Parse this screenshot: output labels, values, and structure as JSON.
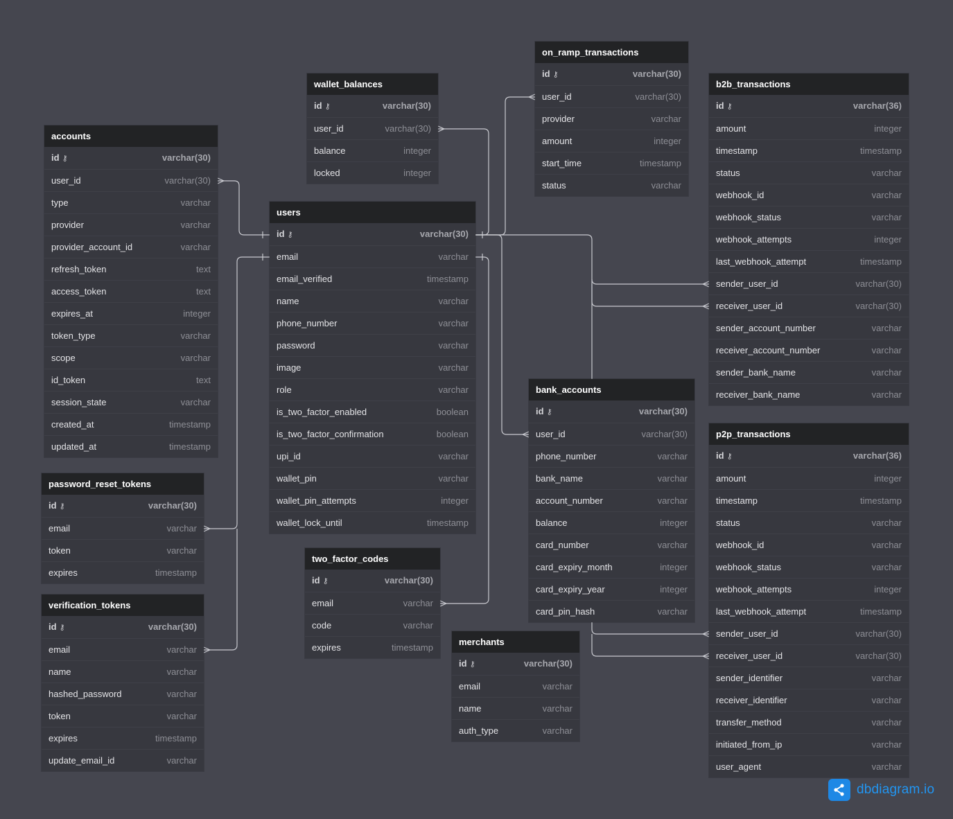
{
  "brand": {
    "name": "dbdiagram.io",
    "logo_icon": "share-nodes-icon"
  },
  "colors": {
    "background": "#45464f",
    "table_body": "#37383f",
    "table_header": "#222325",
    "link": "#c9cad0",
    "brand": "#2196f3"
  },
  "tables": [
    {
      "id": "accounts",
      "name": "accounts",
      "fields": [
        {
          "name": "id",
          "type": "varchar(30)",
          "pk": true
        },
        {
          "name": "user_id",
          "type": "varchar(30)"
        },
        {
          "name": "type",
          "type": "varchar"
        },
        {
          "name": "provider",
          "type": "varchar"
        },
        {
          "name": "provider_account_id",
          "type": "varchar"
        },
        {
          "name": "refresh_token",
          "type": "text"
        },
        {
          "name": "access_token",
          "type": "text"
        },
        {
          "name": "expires_at",
          "type": "integer"
        },
        {
          "name": "token_type",
          "type": "varchar"
        },
        {
          "name": "scope",
          "type": "varchar"
        },
        {
          "name": "id_token",
          "type": "text"
        },
        {
          "name": "session_state",
          "type": "varchar"
        },
        {
          "name": "created_at",
          "type": "timestamp"
        },
        {
          "name": "updated_at",
          "type": "timestamp"
        }
      ]
    },
    {
      "id": "password_reset_tokens",
      "name": "password_reset_tokens",
      "fields": [
        {
          "name": "id",
          "type": "varchar(30)",
          "pk": true
        },
        {
          "name": "email",
          "type": "varchar"
        },
        {
          "name": "token",
          "type": "varchar"
        },
        {
          "name": "expires",
          "type": "timestamp"
        }
      ]
    },
    {
      "id": "verification_tokens",
      "name": "verification_tokens",
      "fields": [
        {
          "name": "id",
          "type": "varchar(30)",
          "pk": true
        },
        {
          "name": "email",
          "type": "varchar"
        },
        {
          "name": "name",
          "type": "varchar"
        },
        {
          "name": "hashed_password",
          "type": "varchar"
        },
        {
          "name": "token",
          "type": "varchar"
        },
        {
          "name": "expires",
          "type": "timestamp"
        },
        {
          "name": "update_email_id",
          "type": "varchar"
        }
      ]
    },
    {
      "id": "wallet_balances",
      "name": "wallet_balances",
      "fields": [
        {
          "name": "id",
          "type": "varchar(30)",
          "pk": true
        },
        {
          "name": "user_id",
          "type": "varchar(30)"
        },
        {
          "name": "balance",
          "type": "integer"
        },
        {
          "name": "locked",
          "type": "integer"
        }
      ]
    },
    {
      "id": "users",
      "name": "users",
      "fields": [
        {
          "name": "id",
          "type": "varchar(30)",
          "pk": true
        },
        {
          "name": "email",
          "type": "varchar"
        },
        {
          "name": "email_verified",
          "type": "timestamp"
        },
        {
          "name": "name",
          "type": "varchar"
        },
        {
          "name": "phone_number",
          "type": "varchar"
        },
        {
          "name": "password",
          "type": "varchar"
        },
        {
          "name": "image",
          "type": "varchar"
        },
        {
          "name": "role",
          "type": "varchar"
        },
        {
          "name": "is_two_factor_enabled",
          "type": "boolean"
        },
        {
          "name": "is_two_factor_confirmation",
          "type": "boolean"
        },
        {
          "name": "upi_id",
          "type": "varchar"
        },
        {
          "name": "wallet_pin",
          "type": "varchar"
        },
        {
          "name": "wallet_pin_attempts",
          "type": "integer"
        },
        {
          "name": "wallet_lock_until",
          "type": "timestamp"
        }
      ]
    },
    {
      "id": "two_factor_codes",
      "name": "two_factor_codes",
      "fields": [
        {
          "name": "id",
          "type": "varchar(30)",
          "pk": true
        },
        {
          "name": "email",
          "type": "varchar"
        },
        {
          "name": "code",
          "type": "varchar"
        },
        {
          "name": "expires",
          "type": "timestamp"
        }
      ]
    },
    {
      "id": "on_ramp_transactions",
      "name": "on_ramp_transactions",
      "fields": [
        {
          "name": "id",
          "type": "varchar(30)",
          "pk": true
        },
        {
          "name": "user_id",
          "type": "varchar(30)"
        },
        {
          "name": "provider",
          "type": "varchar"
        },
        {
          "name": "amount",
          "type": "integer"
        },
        {
          "name": "start_time",
          "type": "timestamp"
        },
        {
          "name": "status",
          "type": "varchar"
        }
      ]
    },
    {
      "id": "bank_accounts",
      "name": "bank_accounts",
      "fields": [
        {
          "name": "id",
          "type": "varchar(30)",
          "pk": true
        },
        {
          "name": "user_id",
          "type": "varchar(30)"
        },
        {
          "name": "phone_number",
          "type": "varchar"
        },
        {
          "name": "bank_name",
          "type": "varchar"
        },
        {
          "name": "account_number",
          "type": "varchar"
        },
        {
          "name": "balance",
          "type": "integer"
        },
        {
          "name": "card_number",
          "type": "varchar"
        },
        {
          "name": "card_expiry_month",
          "type": "integer"
        },
        {
          "name": "card_expiry_year",
          "type": "integer"
        },
        {
          "name": "card_pin_hash",
          "type": "varchar"
        }
      ]
    },
    {
      "id": "merchants",
      "name": "merchants",
      "fields": [
        {
          "name": "id",
          "type": "varchar(30)",
          "pk": true
        },
        {
          "name": "email",
          "type": "varchar"
        },
        {
          "name": "name",
          "type": "varchar"
        },
        {
          "name": "auth_type",
          "type": "varchar"
        }
      ]
    },
    {
      "id": "b2b_transactions",
      "name": "b2b_transactions",
      "fields": [
        {
          "name": "id",
          "type": "varchar(36)",
          "pk": true
        },
        {
          "name": "amount",
          "type": "integer"
        },
        {
          "name": "timestamp",
          "type": "timestamp"
        },
        {
          "name": "status",
          "type": "varchar"
        },
        {
          "name": "webhook_id",
          "type": "varchar"
        },
        {
          "name": "webhook_status",
          "type": "varchar"
        },
        {
          "name": "webhook_attempts",
          "type": "integer"
        },
        {
          "name": "last_webhook_attempt",
          "type": "timestamp"
        },
        {
          "name": "sender_user_id",
          "type": "varchar(30)"
        },
        {
          "name": "receiver_user_id",
          "type": "varchar(30)"
        },
        {
          "name": "sender_account_number",
          "type": "varchar"
        },
        {
          "name": "receiver_account_number",
          "type": "varchar"
        },
        {
          "name": "sender_bank_name",
          "type": "varchar"
        },
        {
          "name": "receiver_bank_name",
          "type": "varchar"
        }
      ]
    },
    {
      "id": "p2p_transactions",
      "name": "p2p_transactions",
      "fields": [
        {
          "name": "id",
          "type": "varchar(36)",
          "pk": true
        },
        {
          "name": "amount",
          "type": "integer"
        },
        {
          "name": "timestamp",
          "type": "timestamp"
        },
        {
          "name": "status",
          "type": "varchar"
        },
        {
          "name": "webhook_id",
          "type": "varchar"
        },
        {
          "name": "webhook_status",
          "type": "varchar"
        },
        {
          "name": "webhook_attempts",
          "type": "integer"
        },
        {
          "name": "last_webhook_attempt",
          "type": "timestamp"
        },
        {
          "name": "sender_user_id",
          "type": "varchar(30)"
        },
        {
          "name": "receiver_user_id",
          "type": "varchar(30)"
        },
        {
          "name": "sender_identifier",
          "type": "varchar"
        },
        {
          "name": "receiver_identifier",
          "type": "varchar"
        },
        {
          "name": "transfer_method",
          "type": "varchar"
        },
        {
          "name": "initiated_from_ip",
          "type": "varchar"
        },
        {
          "name": "user_agent",
          "type": "varchar"
        }
      ]
    }
  ],
  "relationships": [
    {
      "from": "accounts.user_id",
      "to": "users.id"
    },
    {
      "from": "wallet_balances.user_id",
      "to": "users.id"
    },
    {
      "from": "on_ramp_transactions.user_id",
      "to": "users.id"
    },
    {
      "from": "bank_accounts.user_id",
      "to": "users.id"
    },
    {
      "from": "b2b_transactions.sender_user_id",
      "to": "users.id"
    },
    {
      "from": "b2b_transactions.receiver_user_id",
      "to": "users.id"
    },
    {
      "from": "password_reset_tokens.email",
      "to": "users.email"
    },
    {
      "from": "verification_tokens.email",
      "to": "users.email"
    },
    {
      "from": "two_factor_codes.email",
      "to": "users.email"
    },
    {
      "from": "p2p_transactions.sender_user_id",
      "to": "bank_accounts.id"
    },
    {
      "from": "p2p_transactions.receiver_user_id",
      "to": "bank_accounts.id"
    }
  ]
}
